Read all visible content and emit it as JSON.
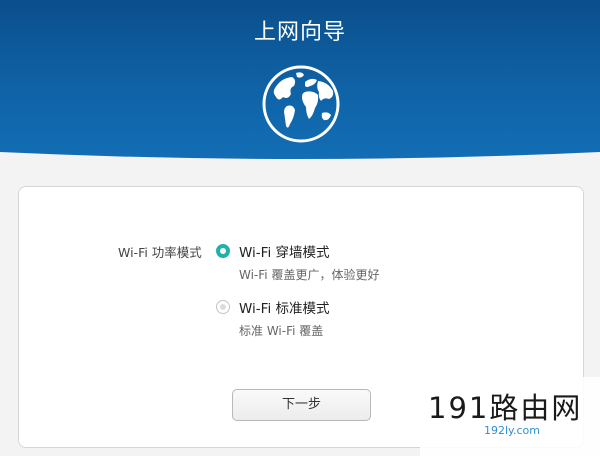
{
  "header": {
    "title": "上网向导",
    "icon": "globe-icon"
  },
  "form": {
    "field_label": "Wi-Fi 功率模式",
    "options": [
      {
        "label": "Wi-Fi 穿墙模式",
        "description": "Wi-Fi 覆盖更广，体验更好",
        "selected": true
      },
      {
        "label": "Wi-Fi 标准模式",
        "description": "标准 Wi-Fi 覆盖",
        "selected": false
      }
    ],
    "next_label": "下一步"
  },
  "watermark": {
    "text": "191路由网",
    "url": "192ly.com"
  },
  "colors": {
    "header_top": "#0b4f8c",
    "header_bottom": "#1470b8",
    "radio_selected": "#20b2aa"
  }
}
